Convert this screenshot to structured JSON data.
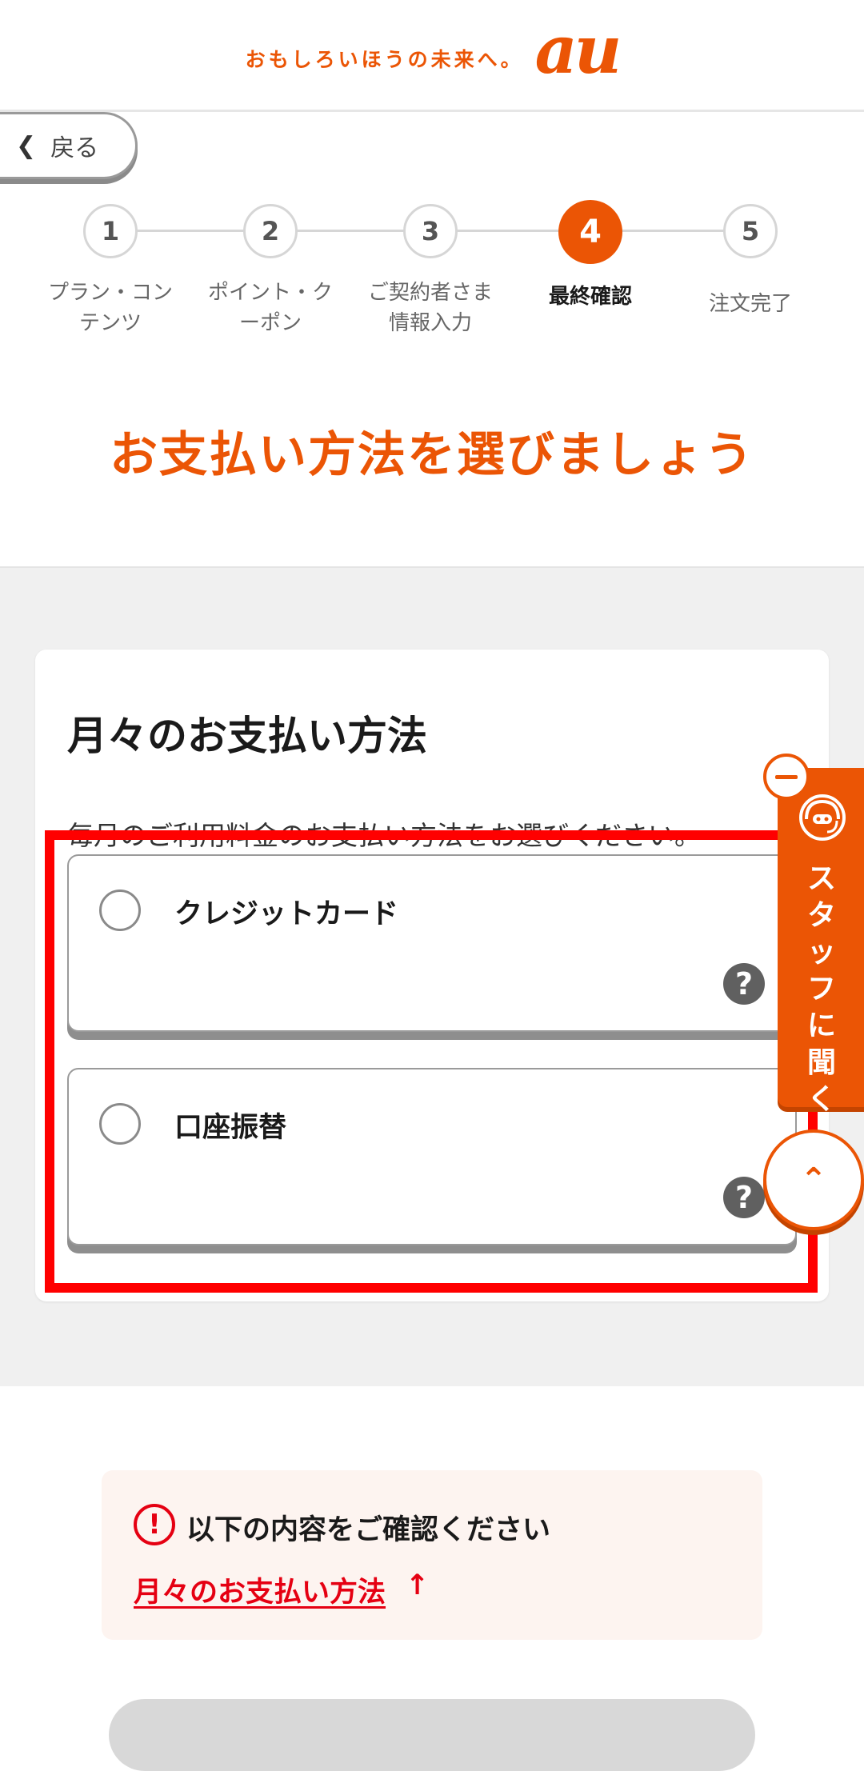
{
  "header": {
    "tagline": "おもしろいほうの未来へ。",
    "logo": "au"
  },
  "back": {
    "label": "戻る"
  },
  "stepper": {
    "steps": [
      {
        "number": "1",
        "label_line1": "プラン・コン",
        "label_line2": "テンツ"
      },
      {
        "number": "2",
        "label_line1": "ポイント・ク",
        "label_line2": "ーポン"
      },
      {
        "number": "3",
        "label_line1": "ご契約者さま",
        "label_line2": "情報入力"
      },
      {
        "number": "4",
        "label_line1": "最終確認",
        "label_line2": ""
      },
      {
        "number": "5",
        "label_line1": "注文完了",
        "label_line2": ""
      }
    ],
    "active_step": 4
  },
  "page_title": "お支払い方法を選びましょう",
  "payment": {
    "title": "月々のお支払い方法",
    "description": "毎月のご利用料金のお支払い方法をお選びください。",
    "options": [
      {
        "label": "クレジットカード"
      },
      {
        "label": "口座振替"
      }
    ]
  },
  "staff": {
    "label": "スタッフに聞く"
  },
  "confirm": {
    "message": "以下の内容をご確認ください",
    "link": "月々のお支払い方法"
  },
  "colors": {
    "brand": "#eb5505",
    "error": "#e50012",
    "highlight": "#ff0000"
  }
}
